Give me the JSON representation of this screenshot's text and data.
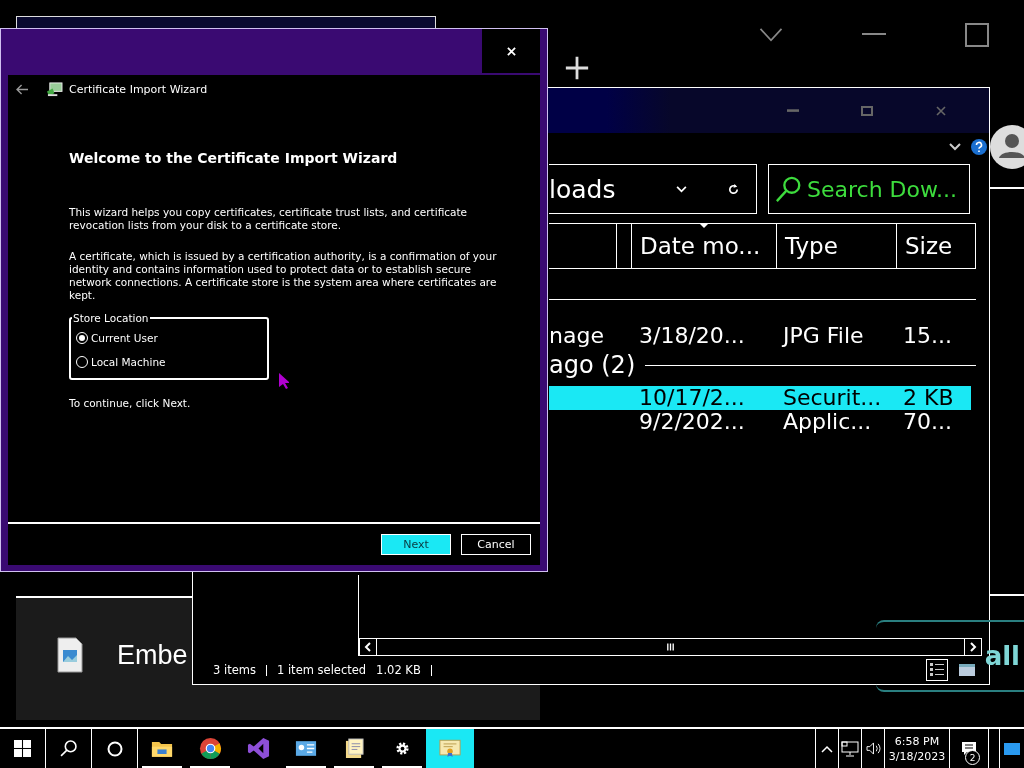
{
  "explorer": {
    "address": "loads",
    "search_placeholder": "Search Dow...",
    "columns": [
      "Date mo...",
      "Type",
      "Size"
    ],
    "items": [
      {
        "kind": "row",
        "name": "nage",
        "date": "3/18/20...",
        "type": "JPG File",
        "size": "15...",
        "selected": false
      },
      {
        "kind": "group",
        "title": "ago (2)"
      },
      {
        "kind": "row",
        "date": "10/17/2...",
        "type": "Securit...",
        "size": "2 KB",
        "selected": true
      },
      {
        "kind": "row",
        "date": "9/2/202...",
        "type": "Applic...",
        "size": "70...",
        "selected": false
      }
    ],
    "status": [
      "3 items",
      "1 item selected",
      "1.02 KB"
    ]
  },
  "wizard": {
    "title": "Certificate Import Wizard",
    "heading": "Welcome to the Certificate Import Wizard",
    "paragraphs": [
      "This wizard helps you copy certificates, certificate trust lists, and certificate revocation lists from your disk to a certificate store.",
      "A certificate, which is issued by a certification authority, is a confirmation of your identity and contains information used to protect data or to establish secure network connections. A certificate store is the system area where certificates are kept."
    ],
    "store_location": {
      "label": "Store Location",
      "options": [
        {
          "label": "Current User",
          "selected": true
        },
        {
          "label": "Local Machine",
          "selected": false
        }
      ]
    },
    "hint": "To continue, click Next.",
    "buttons": [
      {
        "label": "Next",
        "default": true
      },
      {
        "label": "Cancel",
        "default": false
      }
    ]
  },
  "background": {
    "file_name": "Embe",
    "side_text": "all"
  },
  "taskbar": {
    "apps": [
      {
        "kind": "folder",
        "running": true,
        "active": false
      },
      {
        "kind": "chrome",
        "running": true,
        "active": false
      },
      {
        "kind": "studio",
        "running": false,
        "active": false
      },
      {
        "kind": "card",
        "running": true,
        "active": false
      },
      {
        "kind": "notes",
        "running": true,
        "active": false
      },
      {
        "kind": "gear",
        "running": true,
        "active": false
      },
      {
        "kind": "certificate",
        "running": false,
        "active": true
      }
    ],
    "time": "6:58 PM",
    "date": "3/18/2023",
    "notifications": "2"
  }
}
